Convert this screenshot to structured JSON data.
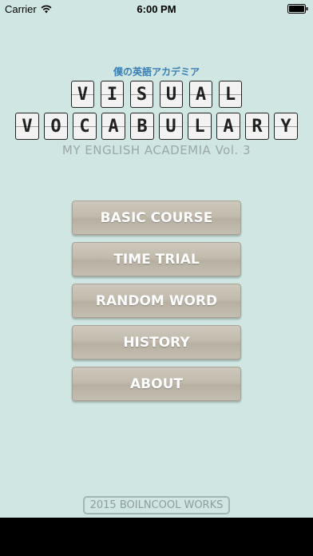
{
  "status_bar": {
    "carrier": "Carrier",
    "time": "6:00 PM",
    "wifi_icon": "wifi-icon",
    "battery_icon": "battery-icon"
  },
  "header": {
    "subtitle_jp": "僕の英語アカデミア",
    "title_line1": [
      "V",
      "I",
      "S",
      "U",
      "A",
      "L"
    ],
    "title_line2": [
      "V",
      "O",
      "C",
      "A",
      "B",
      "U",
      "L",
      "A",
      "R",
      "Y"
    ],
    "academia": "MY ENGLISH ACADEMIA Vol. 3"
  },
  "menu": {
    "items": [
      {
        "label": "BASIC COURSE"
      },
      {
        "label": "TIME TRIAL"
      },
      {
        "label": "RANDOM WORD"
      },
      {
        "label": "HISTORY"
      },
      {
        "label": "ABOUT"
      }
    ]
  },
  "footer": {
    "credit": "2015 BOILNCOOL WORKS"
  },
  "colors": {
    "background": "#cfe6e2",
    "button": "#c1baad",
    "subtitle": "#3a7fb6"
  }
}
